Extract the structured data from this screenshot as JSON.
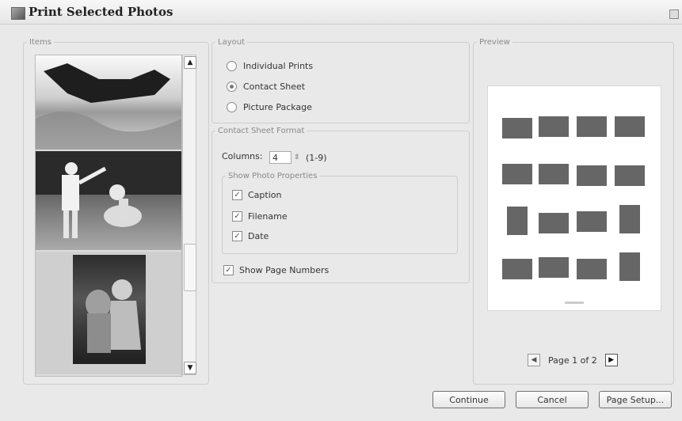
{
  "window": {
    "title": "Print Selected Photos"
  },
  "items": {
    "legend": "Items"
  },
  "layout": {
    "legend": "Layout",
    "options": [
      "Individual Prints",
      "Contact Sheet",
      "Picture Package"
    ],
    "selected": "Contact Sheet"
  },
  "contact_sheet": {
    "legend": "Contact Sheet Format",
    "columns_label": "Columns:",
    "columns_value": "4",
    "columns_range": "(1-9)",
    "props_legend": "Show Photo Properties",
    "caption": "Caption",
    "filename": "Filename",
    "date": "Date",
    "page_numbers": "Show Page Numbers"
  },
  "preview": {
    "legend": "Preview",
    "page_text": "Page 1 of 2"
  },
  "buttons": {
    "continue": "Continue",
    "cancel": "Cancel",
    "page_setup": "Page Setup..."
  },
  "icons": {
    "scroll_up": "scroll-up-icon",
    "scroll_down": "scroll-down-icon",
    "prev_page": "prev-page-icon",
    "next_page": "next-page-icon"
  }
}
